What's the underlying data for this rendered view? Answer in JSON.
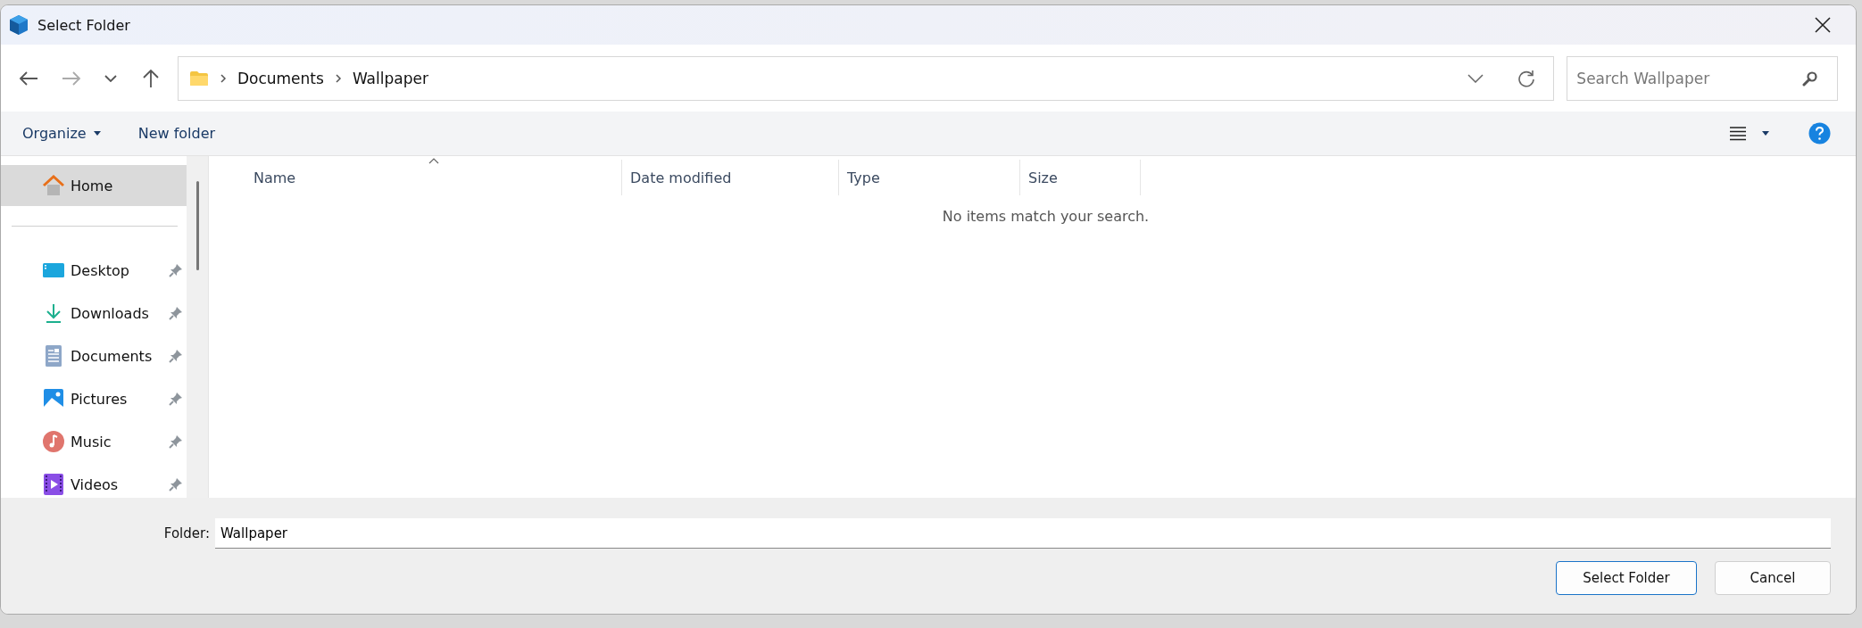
{
  "window": {
    "title": "Select Folder"
  },
  "address": {
    "crumbs": [
      "Documents",
      "Wallpaper"
    ]
  },
  "search": {
    "placeholder": "Search Wallpaper"
  },
  "toolbar": {
    "organize": "Organize",
    "new_folder": "New folder"
  },
  "sidebar": {
    "items": [
      {
        "kind": "home",
        "label": "Home",
        "selected": true,
        "pinned": false
      },
      {
        "kind": "desktop",
        "label": "Desktop",
        "selected": false,
        "pinned": true
      },
      {
        "kind": "downloads",
        "label": "Downloads",
        "selected": false,
        "pinned": true
      },
      {
        "kind": "documents",
        "label": "Documents",
        "selected": false,
        "pinned": true
      },
      {
        "kind": "pictures",
        "label": "Pictures",
        "selected": false,
        "pinned": true
      },
      {
        "kind": "music",
        "label": "Music",
        "selected": false,
        "pinned": true
      },
      {
        "kind": "videos",
        "label": "Videos",
        "selected": false,
        "pinned": true
      }
    ]
  },
  "table": {
    "columns": [
      "Name",
      "Date modified",
      "Type",
      "Size"
    ],
    "empty_message": "No items match your search."
  },
  "folder": {
    "label": "Folder:",
    "value": "Wallpaper"
  },
  "buttons": [
    "Select Folder",
    "Cancel"
  ]
}
